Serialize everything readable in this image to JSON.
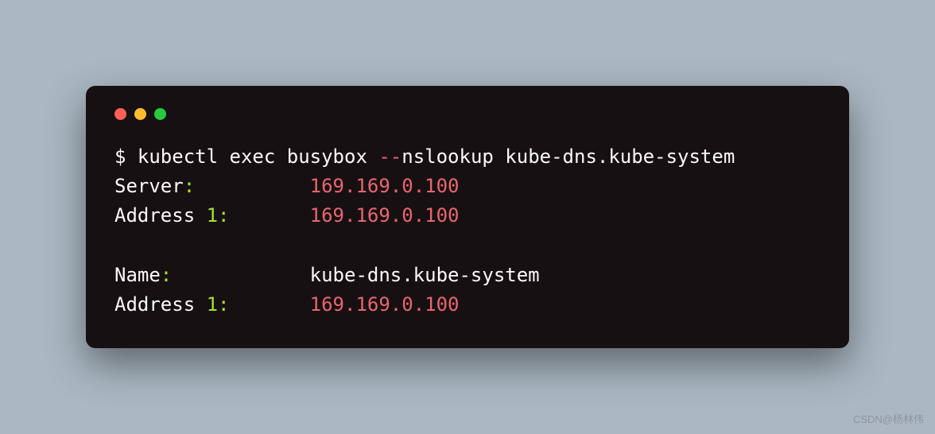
{
  "prompt": "$",
  "command": {
    "base": "kubectl exec busybox",
    "flag": "--",
    "rest": "nslookup kube-dns.kube-system"
  },
  "lines": [
    {
      "label": "Server",
      "colon": ":",
      "pad": "          ",
      "value": "169.169.0.100",
      "valueClass": "ip"
    },
    {
      "label": "Address ",
      "num": "1",
      "colon": ":",
      "pad": "       ",
      "value": "169.169.0.100",
      "valueClass": "ip"
    },
    {
      "blank": true
    },
    {
      "label": "Name",
      "colon": ":",
      "pad": "            ",
      "value": "kube-dns.kube-system",
      "valueClass": "val"
    },
    {
      "label": "Address ",
      "num": "1",
      "colon": ":",
      "pad": "       ",
      "value": "169.169.0.100",
      "valueClass": "ip"
    }
  ],
  "watermark": "CSDN@杨林伟"
}
